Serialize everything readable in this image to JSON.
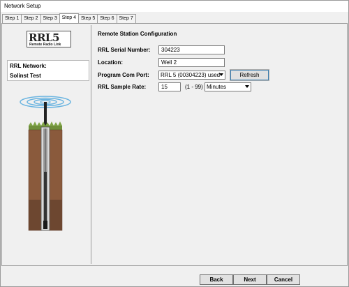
{
  "window": {
    "title": "Network Setup"
  },
  "tabs": [
    {
      "label": "Step 1"
    },
    {
      "label": "Step 2"
    },
    {
      "label": "Step 3"
    },
    {
      "label": "Step 4",
      "active": true
    },
    {
      "label": "Step 5"
    },
    {
      "label": "Step 6"
    },
    {
      "label": "Step 7"
    }
  ],
  "sidebar": {
    "logo": {
      "main": "RRL5",
      "sub": "Remote Radio Link"
    },
    "network_label": "RRL Network:",
    "network_value": "Solinst Test",
    "illustration": "well-probe-radio-illustration"
  },
  "main": {
    "title": "Remote Station Configuration",
    "serial": {
      "label": "RRL Serial Number:",
      "value": "304223"
    },
    "location": {
      "label": "Location:",
      "value": "Well 2"
    },
    "com_port": {
      "label": "Program Com Port:",
      "value": "RRL 5 (00304223) used",
      "refresh": "Refresh"
    },
    "sample_rate": {
      "label": "RRL Sample Rate:",
      "value": "15",
      "range": "(1 - 99)",
      "unit": "Minutes"
    }
  },
  "footer": {
    "back": "Back",
    "next": "Next",
    "cancel": "Cancel"
  },
  "colors": {
    "window_bg": "#f0f0f0",
    "border": "#9a9a9a",
    "focus_border": "#3c7fb1"
  }
}
